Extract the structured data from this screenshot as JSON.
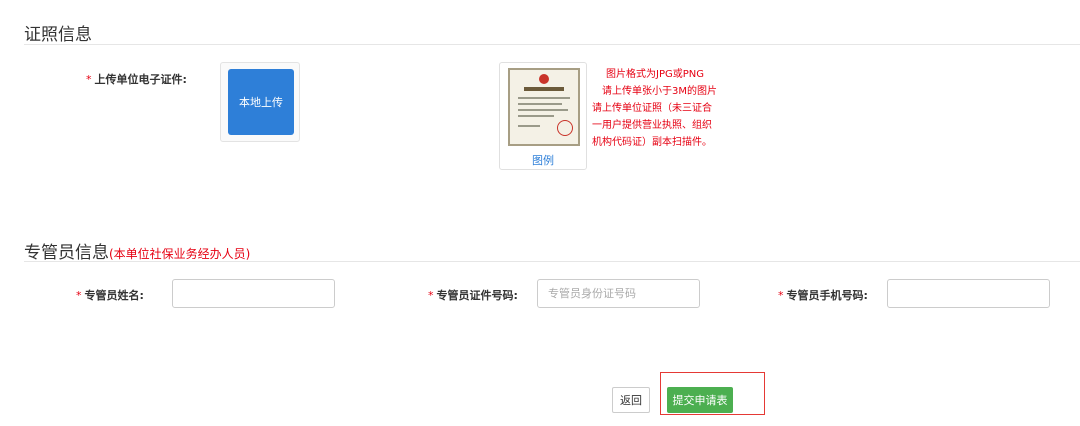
{
  "cert_section": {
    "title": "证照信息",
    "upload_label": "上传单位电子证件:",
    "required_mark": "*",
    "upload_button": "本地上传",
    "example_caption": "图例",
    "hints": [
      "图片格式为JPG或PNG",
      "请上传单张小于3M的图片",
      "请上传单位证照（未三证合",
      "一用户提供营业执照、组织",
      "机构代码证）副本扫描件。"
    ]
  },
  "manager_section": {
    "title": "专管员信息",
    "subtitle": "(本单位社保业务经办人员)",
    "fields": [
      {
        "label": "专管员姓名:",
        "value": "",
        "placeholder": ""
      },
      {
        "label": "专管员证件号码:",
        "value": "",
        "placeholder": "专管员身份证号码"
      },
      {
        "label": "专管员手机号码:",
        "value": "",
        "placeholder": ""
      }
    ]
  },
  "actions": {
    "back": "返回",
    "submit": "提交申请表"
  },
  "colors": {
    "required": "#e60012",
    "upload_blue": "#2e7fd8",
    "submit_green": "#4caf50",
    "highlight_red": "#e53935"
  }
}
